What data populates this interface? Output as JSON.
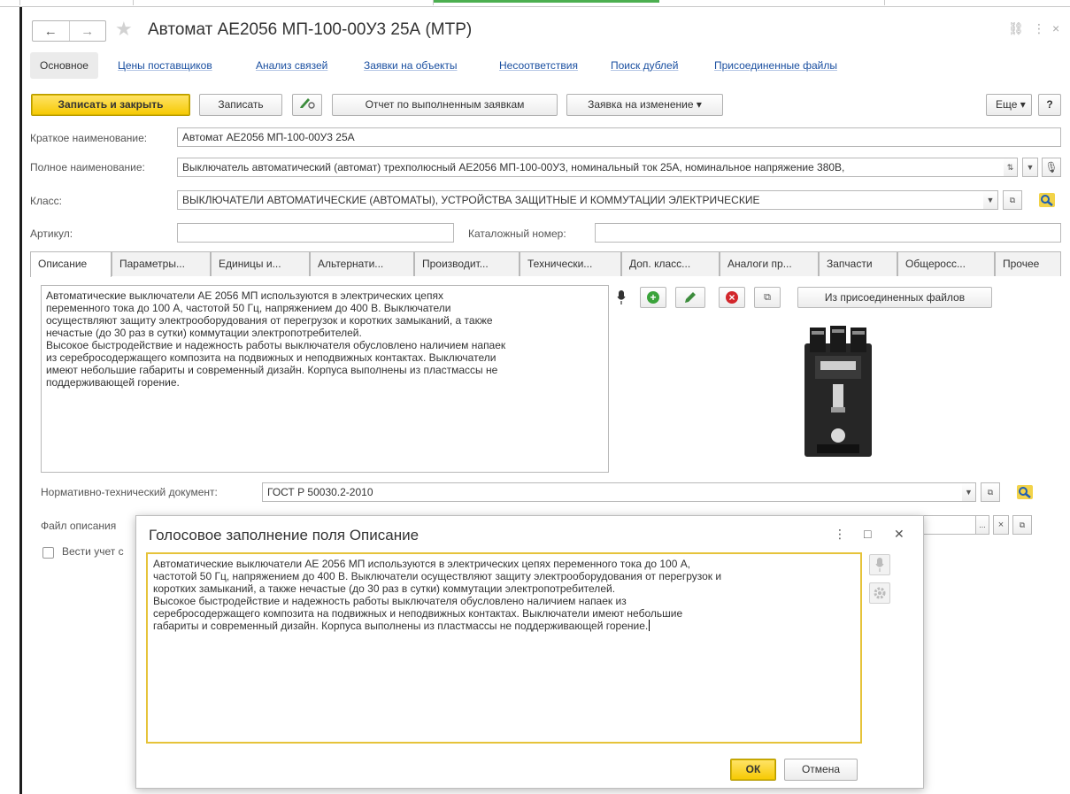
{
  "window": {
    "title": "Автомат АЕ2056 МП-100-00У3 25А (МТР)",
    "nav_back": "←",
    "nav_forward": "→",
    "star": "★",
    "link_glyph": "⛓",
    "more_glyph": "⋮",
    "close_glyph": "×"
  },
  "sections": [
    {
      "label": "Основное"
    },
    {
      "label": "Цены поставщиков"
    },
    {
      "label": "Анализ связей"
    },
    {
      "label": "Заявки на объекты"
    },
    {
      "label": "Несоответствия"
    },
    {
      "label": "Поиск дублей"
    },
    {
      "label": "Присоединенные файлы"
    }
  ],
  "toolbar": {
    "save_close": "Записать и закрыть",
    "save": "Записать",
    "report": "Отчет по выполненным заявкам",
    "change_request": "Заявка на изменение",
    "dropdown_arrow": "▾",
    "more": "Еще",
    "help": "?"
  },
  "form": {
    "short_name_label": "Краткое наименование:",
    "short_name_value": "Автомат АЕ2056 МП-100-00У3 25А",
    "full_name_label": "Полное наименование:",
    "full_name_value": "Выключатель автоматический (автомат) трехполюсный АЕ2056 МП-100-00У3, номинальный ток 25А, номинальное напряжение 380В,",
    "class_label": "Класс:",
    "class_value": "ВЫКЛЮЧАТЕЛИ АВТОМАТИЧЕСКИЕ (АВТОМАТЫ), УСТРОЙСТВА ЗАЩИТНЫЕ И КОММУТАЦИИ ЭЛЕКТРИЧЕСКИЕ",
    "article_label": "Артикул:",
    "article_value": "",
    "catalog_label": "Каталожный номер:",
    "catalog_value": ""
  },
  "tabs": [
    {
      "label": "Описание"
    },
    {
      "label": "Параметры..."
    },
    {
      "label": "Единицы и..."
    },
    {
      "label": "Альтернати..."
    },
    {
      "label": "Производит..."
    },
    {
      "label": "Технически..."
    },
    {
      "label": "Доп. класс..."
    },
    {
      "label": "Аналоги пр..."
    },
    {
      "label": "Запчасти"
    },
    {
      "label": "Общеросс..."
    },
    {
      "label": "Прочее"
    }
  ],
  "description": {
    "text": "Автоматические выключатели АЕ 2056 МП используются в электрических цепях\nпеременного тока до 100 А, частотой 50 Гц, напряжением до 400 В. Выключатели\nосуществляют защиту электрооборудования от перегрузок и коротких замыканий, а также\nнечастые (до 30 раз в сутки) коммутации электропотребителей.\nВысокое быстродействие и надежность работы выключателя обусловлено наличием напаек\nиз серебросодержащего композита на подвижных и неподвижных контактах. Выключатели\nимеют небольшие габариты и современный дизайн. Корпуса выполнены из пластмассы не\nподдерживающей горение.",
    "from_files_button": "Из присоединенных файлов",
    "add_glyph": "+",
    "delete_glyph": "×"
  },
  "normative": {
    "label": "Нормативно-технический документ:",
    "value": "ГОСТ Р 50030.2-2010"
  },
  "file": {
    "label": "Файл описания",
    "ellipsis": "..."
  },
  "keep_record": {
    "label": "Вести учет с"
  },
  "dialog": {
    "title": "Голосовое заполнение поля Описание",
    "text": "Автоматические выключатели АЕ 2056 МП используются в электрических цепях переменного тока до 100 А,\nчастотой 50 Гц, напряжением до 400 В. Выключатели осуществляют защиту электрооборудования от перегрузок и\nкоротких замыканий, а также нечастые (до 30 раз в сутки) коммутации электропотребителей.\nВысокое быстродействие и надежность работы выключателя обусловлено наличием напаек из\nсеребросодержащего композита на подвижных и неподвижных контактах. Выключатели имеют небольшие\nгабариты и современный дизайн. Корпуса выполнены из пластмассы не поддерживающей горение.",
    "ok": "ОК",
    "cancel": "Отмена",
    "more_glyph": "⋮",
    "maximize_glyph": "□",
    "close_glyph": "✕"
  },
  "colors": {
    "accent_yellow": "#f6c900",
    "link_blue": "#1a4fa0",
    "focus_border": "#e6c33a"
  }
}
